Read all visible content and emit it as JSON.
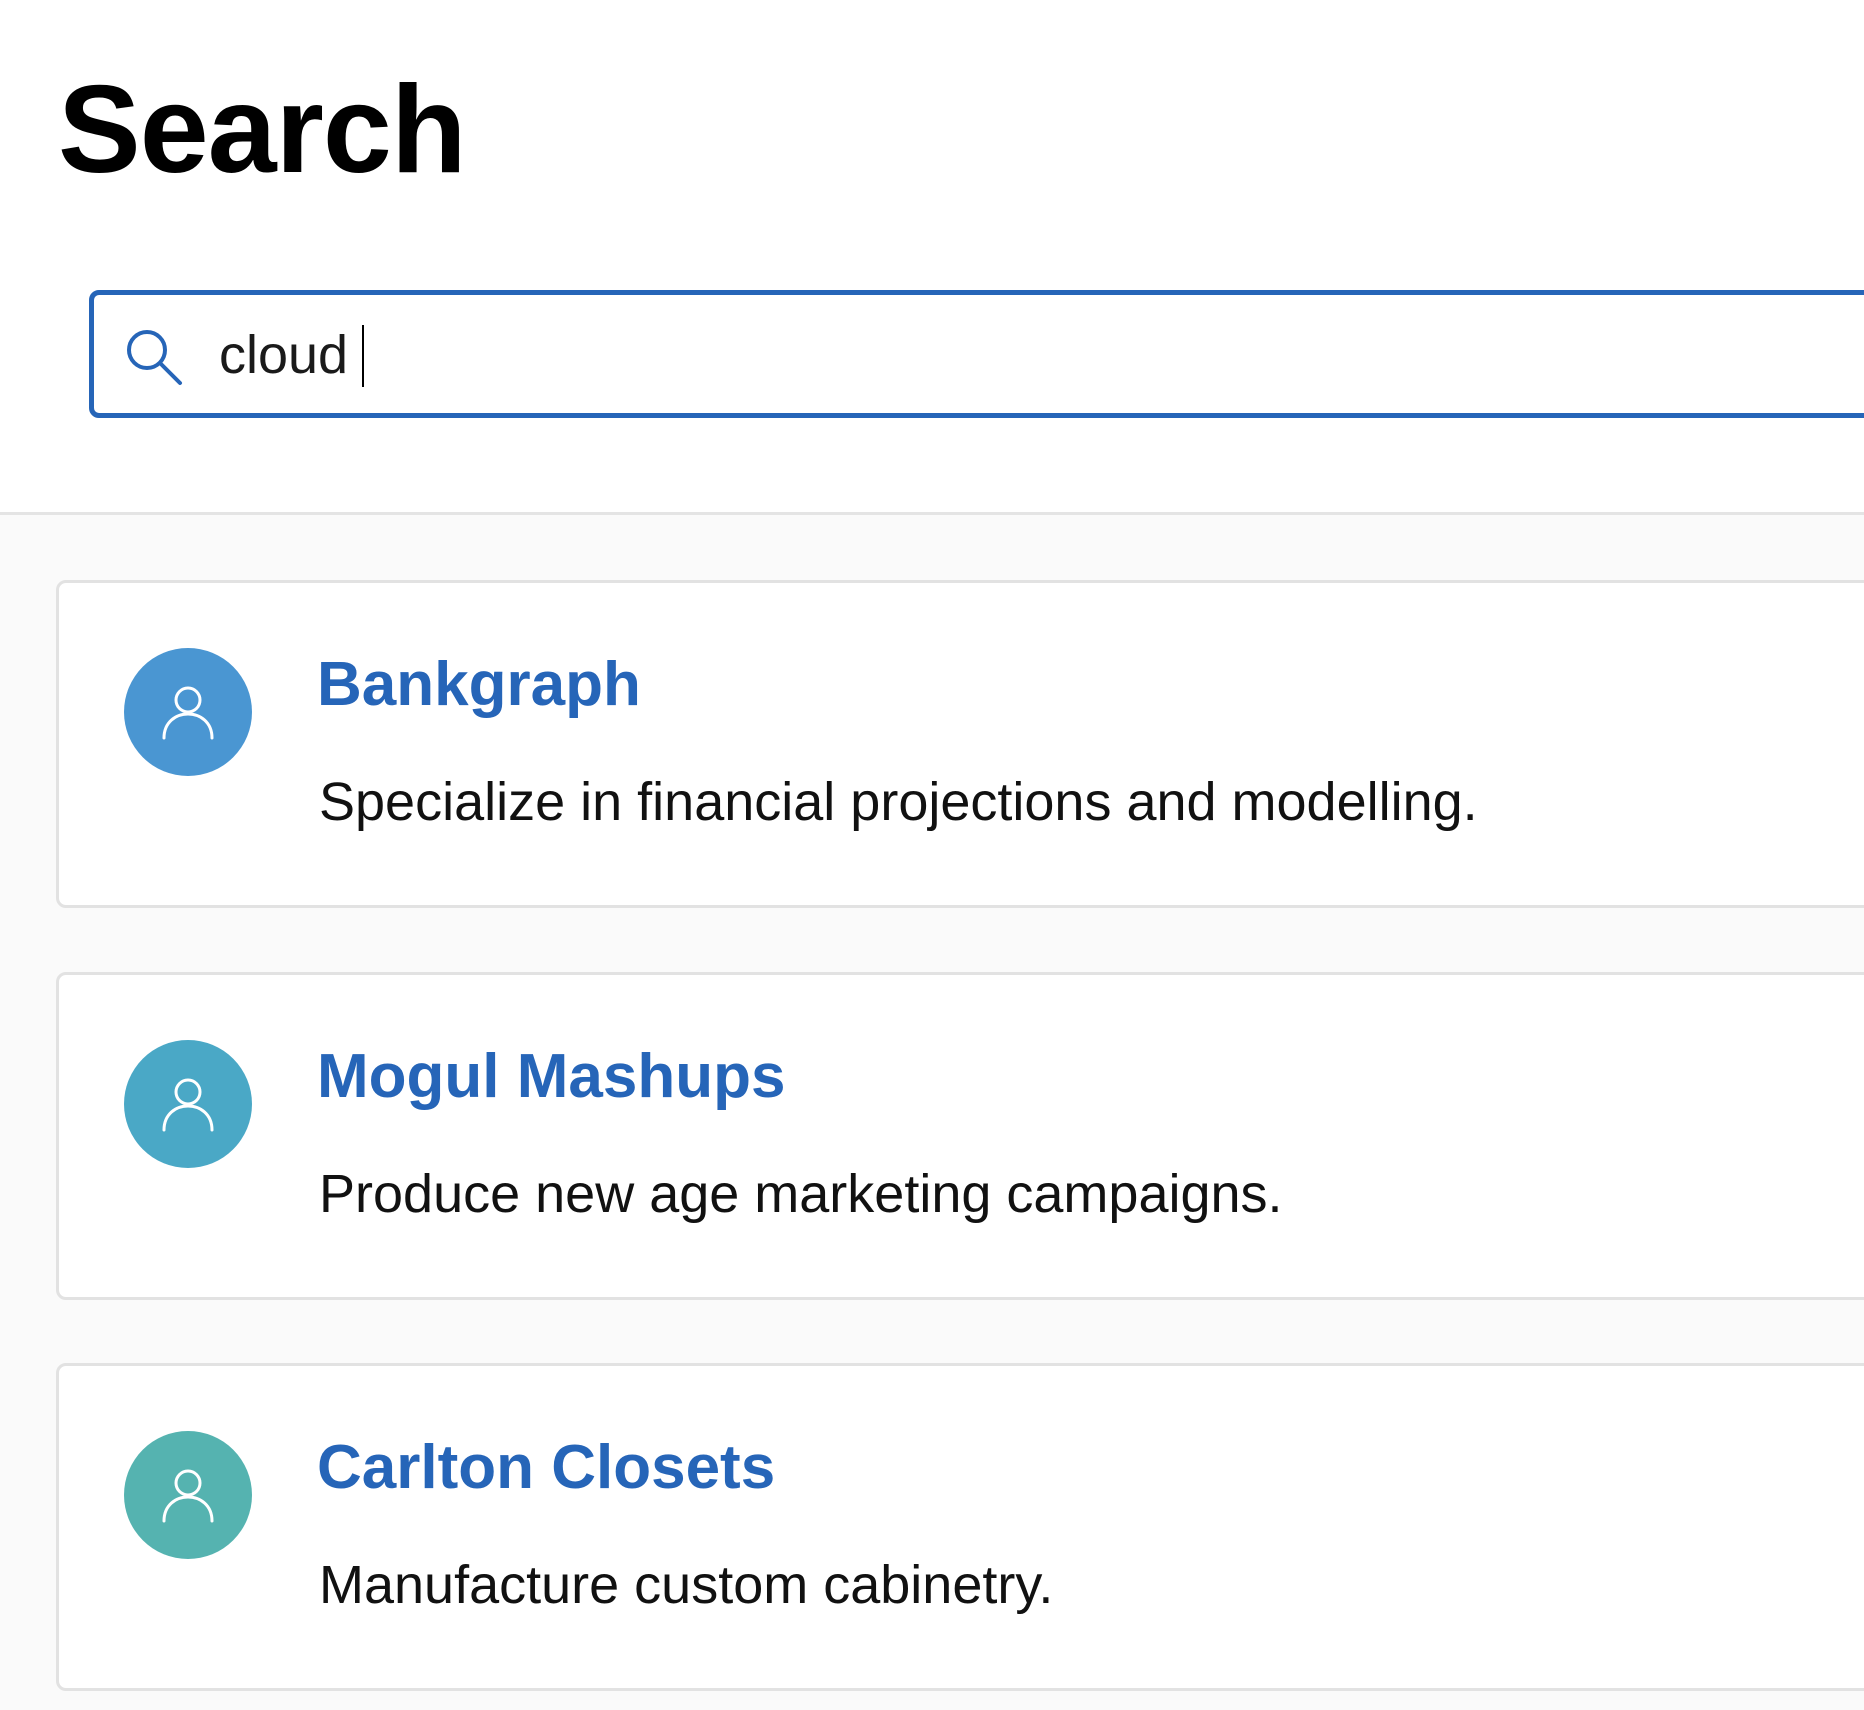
{
  "page": {
    "title": "Search"
  },
  "search": {
    "value": "cloud",
    "placeholder": ""
  },
  "colors": {
    "accent": "#2665b8",
    "avatar_1": "#4a96d2",
    "avatar_2": "#4aa8c6",
    "avatar_3": "#55b3b0"
  },
  "results": [
    {
      "title": "Bankgraph",
      "description": "Specialize in financial projections and modelling.",
      "icon": "person-icon"
    },
    {
      "title": "Mogul Mashups",
      "description": "Produce new age marketing campaigns.",
      "icon": "person-icon"
    },
    {
      "title": "Carlton Closets",
      "description": "Manufacture custom cabinetry.",
      "icon": "person-icon"
    }
  ]
}
